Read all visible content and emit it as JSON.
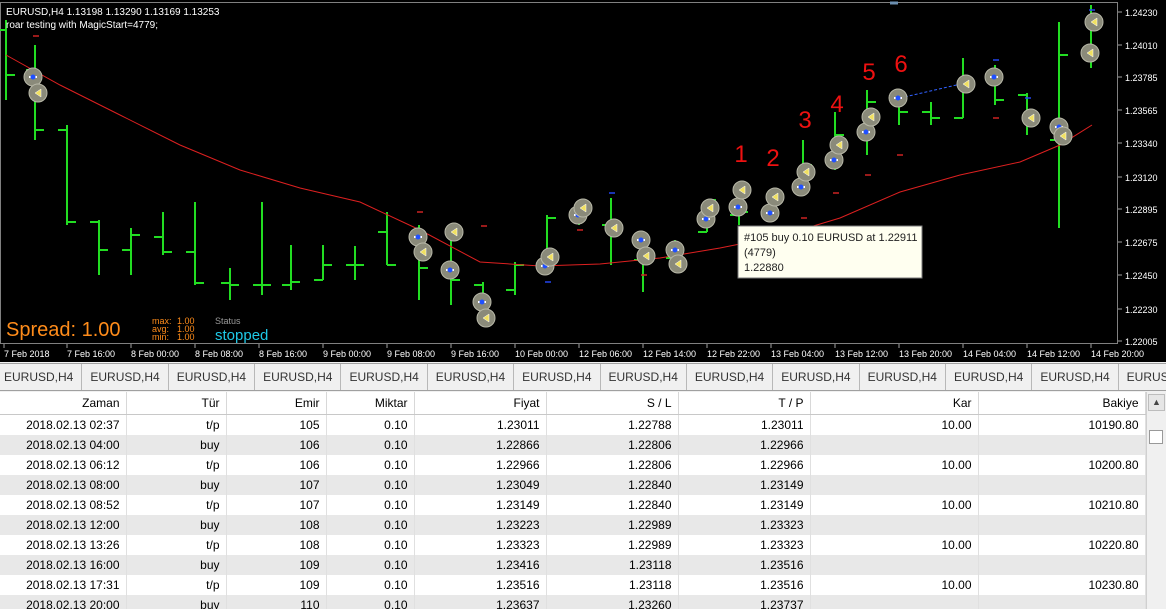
{
  "chart": {
    "header_line1": "EURUSD,H4  1.13198 1.13290 1.13169 1.13253",
    "header_line2": "roar testing with MagicStart=4779;",
    "spread_label": "Spread: 1.00",
    "stats": {
      "max_label": "max:",
      "max_value": "1.00",
      "avg_label": "avg:",
      "avg_value": "1.00",
      "min_label": "min:",
      "min_value": "1.00"
    },
    "status_label": "Status",
    "status_value": "stopped",
    "price_labels": [
      "1.24230",
      "1.24010",
      "1.23785",
      "1.23565",
      "1.23340",
      "1.23120",
      "1.22895",
      "1.22675",
      "1.22450",
      "1.22230",
      "1.22005"
    ],
    "time_labels": [
      "7 Feb 2018",
      "7 Feb 16:00",
      "8 Feb 00:00",
      "8 Feb 08:00",
      "8 Feb 16:00",
      "9 Feb 00:00",
      "9 Feb 08:00",
      "9 Feb 16:00",
      "10 Feb 00:00",
      "12 Feb 06:00",
      "12 Feb 14:00",
      "12 Feb 22:00",
      "13 Feb 04:00",
      "13 Feb 12:00",
      "13 Feb 20:00",
      "14 Feb 04:00",
      "14 Feb 12:00",
      "14 Feb 20:00"
    ],
    "annotations": [
      "1",
      "2",
      "3",
      "4",
      "5",
      "6"
    ],
    "tooltip": {
      "line1": "#105 buy 0.10 EURUSD at 1.22911",
      "line2": "(4779)",
      "line3": "1.22880"
    },
    "colors": {
      "bar": "#22dd22",
      "ma": "#dd2020",
      "background": "#000000",
      "annotation": "#ee1111",
      "spread": "#ff8c1a",
      "status": "#1ec8e6"
    }
  },
  "tabs": [
    "EURUSD,H4",
    "EURUSD,H4",
    "EURUSD,H4",
    "EURUSD,H4",
    "EURUSD,H4",
    "EURUSD,H4",
    "EURUSD,H4",
    "EURUSD,H4",
    "EURUSD,H4",
    "EURUSD,H4",
    "EURUSD,H4",
    "EURUSD,H4",
    "EURUSD,H4",
    "EURUSD,H4",
    "EUR"
  ],
  "table": {
    "headers": [
      "Zaman",
      "Tür",
      "Emir",
      "Miktar",
      "Fiyat",
      "S / L",
      "T / P",
      "Kar",
      "Bakiye"
    ],
    "rows": [
      [
        "2018.02.13 02:37",
        "t/p",
        "105",
        "0.10",
        "1.23011",
        "1.22788",
        "1.23011",
        "10.00",
        "10190.80"
      ],
      [
        "2018.02.13 04:00",
        "buy",
        "106",
        "0.10",
        "1.22866",
        "1.22806",
        "1.22966",
        "",
        ""
      ],
      [
        "2018.02.13 06:12",
        "t/p",
        "106",
        "0.10",
        "1.22966",
        "1.22806",
        "1.22966",
        "10.00",
        "10200.80"
      ],
      [
        "2018.02.13 08:00",
        "buy",
        "107",
        "0.10",
        "1.23049",
        "1.22840",
        "1.23149",
        "",
        ""
      ],
      [
        "2018.02.13 08:52",
        "t/p",
        "107",
        "0.10",
        "1.23149",
        "1.22840",
        "1.23149",
        "10.00",
        "10210.80"
      ],
      [
        "2018.02.13 12:00",
        "buy",
        "108",
        "0.10",
        "1.23223",
        "1.22989",
        "1.23323",
        "",
        ""
      ],
      [
        "2018.02.13 13:26",
        "t/p",
        "108",
        "0.10",
        "1.23323",
        "1.22989",
        "1.23323",
        "10.00",
        "10220.80"
      ],
      [
        "2018.02.13 16:00",
        "buy",
        "109",
        "0.10",
        "1.23416",
        "1.23118",
        "1.23516",
        "",
        ""
      ],
      [
        "2018.02.13 17:31",
        "t/p",
        "109",
        "0.10",
        "1.23516",
        "1.23118",
        "1.23516",
        "10.00",
        "10230.80"
      ],
      [
        "2018.02.13 20:00",
        "buy",
        "110",
        "0.10",
        "1.23637",
        "1.23260",
        "1.23737",
        "",
        ""
      ]
    ]
  }
}
